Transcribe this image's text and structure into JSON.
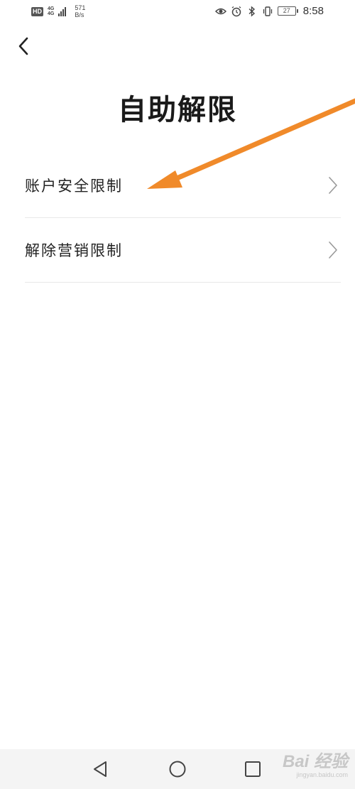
{
  "status_bar": {
    "hd_label": "HD",
    "network_type_top": "4G",
    "network_type_bottom": "4G",
    "net_speed_value": "571",
    "net_speed_unit": "B/s",
    "battery_level": "27",
    "time": "8:58"
  },
  "header": {
    "title": "自助解限"
  },
  "menu": {
    "items": [
      {
        "label": "账户安全限制"
      },
      {
        "label": "解除营销限制"
      }
    ]
  },
  "annotation": {
    "arrow_color": "#f08a2a"
  },
  "watermark": {
    "main": "Bai  经验",
    "sub": "jingyan.baidu.com"
  }
}
